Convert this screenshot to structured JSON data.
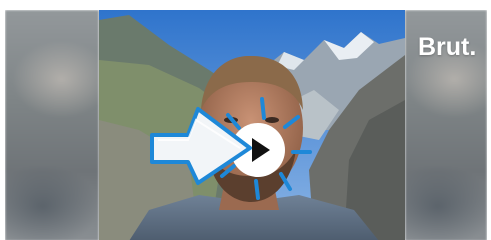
{
  "brand": {
    "logo_text": "Brut."
  },
  "video": {
    "play_icon": "play-icon",
    "cursor_icon": "pointing-arrow-cursor-icon",
    "colors": {
      "accent": "#1e88d8",
      "sky": "#3d7fd0",
      "overlay_white": "#ffffff"
    }
  }
}
